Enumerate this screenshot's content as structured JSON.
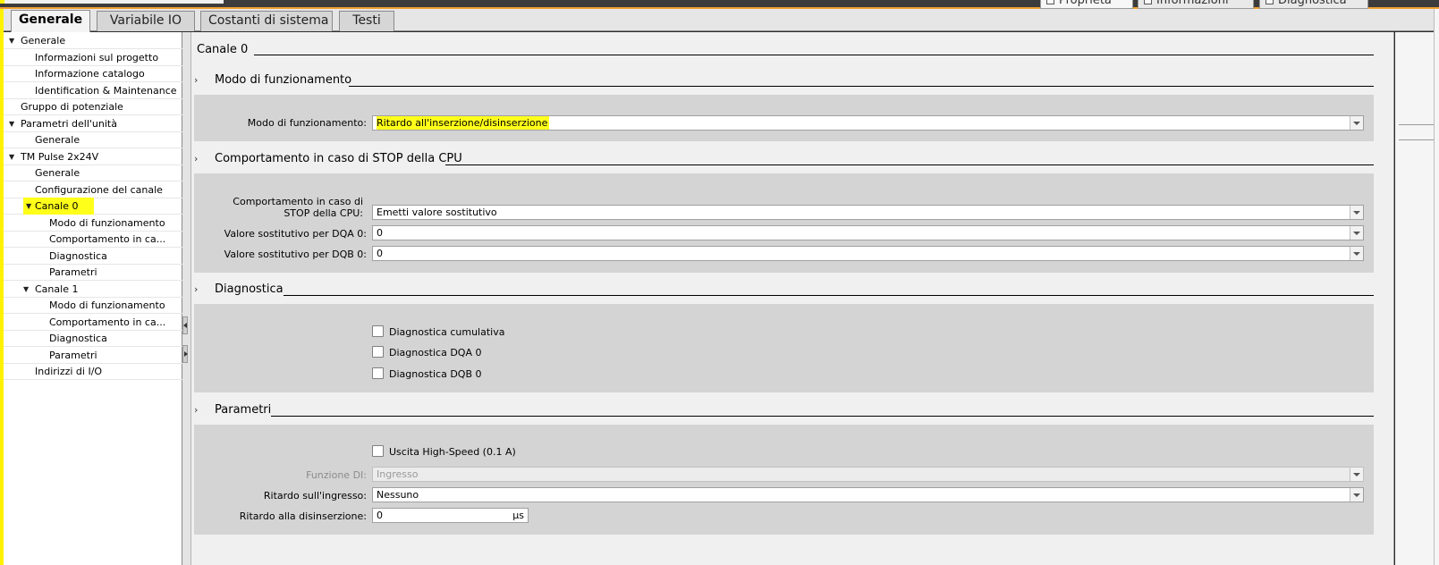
{
  "tabs": [
    "Generale",
    "Variabile IO",
    "Costanti di sistema",
    "Testi"
  ],
  "right_tabs": {
    "props": "Proprietà",
    "info": "Informazioni",
    "diag": "Diagnostica"
  },
  "tree": [
    {
      "label": "Generale",
      "expanded": true
    },
    {
      "label": "Informazioni sul progetto"
    },
    {
      "label": "Informazione catalogo"
    },
    {
      "label": "Identification & Maintenance"
    },
    {
      "label": "Gruppo di potenziale"
    },
    {
      "label": "Parametri dell'unità",
      "expanded": true
    },
    {
      "label": "Generale"
    },
    {
      "label": "TM Pulse 2x24V",
      "expanded": true
    },
    {
      "label": "Generale"
    },
    {
      "label": "Configurazione del canale"
    },
    {
      "label": "Canale 0",
      "expanded": true,
      "selected": true
    },
    {
      "label": "Modo di funzionamento"
    },
    {
      "label": "Comportamento in ca..."
    },
    {
      "label": "Diagnostica"
    },
    {
      "label": "Parametri"
    },
    {
      "label": "Canale 1",
      "expanded": true
    },
    {
      "label": "Modo di funzionamento"
    },
    {
      "label": "Comportamento in ca..."
    },
    {
      "label": "Diagnostica"
    },
    {
      "label": "Parametri"
    },
    {
      "label": "Indirizzi di I/O"
    }
  ],
  "main": {
    "title": "Canale 0",
    "sections": {
      "modo": {
        "title": "Modo di funzionamento",
        "field_label": "Modo di funzionamento:",
        "field_value": "Ritardo all'inserzione/disinserzione"
      },
      "stop": {
        "title": "Comportamento in caso di STOP della CPU",
        "behavior_label": "Comportamento in caso di STOP della CPU:",
        "behavior_value": "Emetti valore sostitutivo",
        "dqa_label": "Valore sostitutivo per DQA 0:",
        "dqa_value": "0",
        "dqb_label": "Valore sostitutivo per DQB 0:",
        "dqb_value": "0"
      },
      "diag": {
        "title": "Diagnostica",
        "checkboxes": [
          "Diagnostica cumulativa",
          "Diagnostica DQA 0",
          "Diagnostica DQB 0"
        ]
      },
      "param": {
        "title": "Parametri",
        "highspeed_label": "Uscita High-Speed (0.1 A)",
        "di_label": "Funzione DI:",
        "di_value": "Ingresso",
        "delay_in_label": "Ritardo sull'ingresso:",
        "delay_in_value": "Nessuno",
        "delay_off_label": "Ritardo alla disinserzione:",
        "delay_off_value": "0",
        "delay_off_unit": "μs"
      }
    }
  },
  "colors": {
    "highlight": "#ffff1a",
    "accent_orange": "#f0a030",
    "panel": "#d4d4d4"
  }
}
